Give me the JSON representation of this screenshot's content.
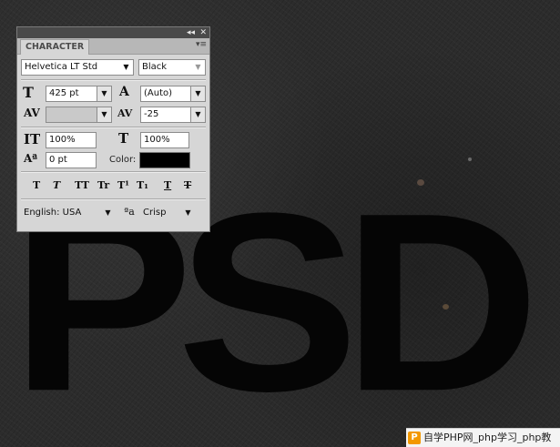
{
  "canvas": {
    "text": "PSD"
  },
  "panel": {
    "tab_label": "CHARACTER",
    "collapse_glyph": "◂◂",
    "close_glyph": "✕",
    "menu_glyph": "▾≡",
    "font_family": "Helvetica LT Std",
    "font_style": "Black",
    "font_size": "425 pt",
    "leading": "(Auto)",
    "kerning": "",
    "tracking": "-25",
    "vertical_scale": "100%",
    "horizontal_scale": "100%",
    "baseline_shift": "0 pt",
    "color_label": "Color:",
    "color_value": "#000000",
    "language": "English: USA",
    "antialias": "Crisp",
    "style_buttons": [
      "T",
      "T",
      "TT",
      "Tr",
      "T¹",
      "T₁",
      "T",
      "T"
    ]
  },
  "watermark": {
    "logo": "P",
    "text": "自学PHP网_php学习_php教"
  }
}
